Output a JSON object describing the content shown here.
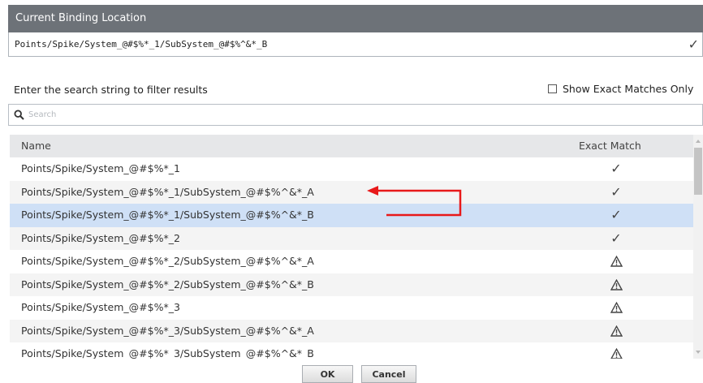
{
  "header": {
    "title": "Current Binding Location"
  },
  "binding": {
    "path": "Points/Spike/System_@#$%*_1/SubSystem_@#$%^&*_B",
    "check_icon": "check-icon"
  },
  "filter": {
    "label": "Enter the search string to filter results",
    "exact_only_label": "Show Exact Matches Only",
    "exact_only_checked": false,
    "search_placeholder": "Search",
    "search_value": ""
  },
  "table": {
    "columns": {
      "name": "Name",
      "exact_match": "Exact Match"
    },
    "rows": [
      {
        "name": "Points/Spike/System_@#$%*_1",
        "match": "check"
      },
      {
        "name": "Points/Spike/System_@#$%*_1/SubSystem_@#$%^&*_A",
        "match": "check"
      },
      {
        "name": "Points/Spike/System_@#$%*_1/SubSystem_@#$%^&*_B",
        "match": "check",
        "selected": true
      },
      {
        "name": "Points/Spike/System_@#$%*_2",
        "match": "check"
      },
      {
        "name": "Points/Spike/System_@#$%*_2/SubSystem_@#$%^&*_A",
        "match": "warning"
      },
      {
        "name": "Points/Spike/System_@#$%*_2/SubSystem_@#$%^&*_B",
        "match": "warning"
      },
      {
        "name": "Points/Spike/System_@#$%*_3",
        "match": "warning"
      },
      {
        "name": "Points/Spike/System_@#$%*_3/SubSystem_@#$%^&*_A",
        "match": "warning"
      },
      {
        "name": "Points/Spike/System_@#$%*_3/SubSystem_@#$%^&*_B",
        "match": "warning"
      }
    ]
  },
  "buttons": {
    "ok": "OK",
    "cancel": "Cancel"
  },
  "colors": {
    "header_bg": "#6d7278",
    "selected_row": "#cfe0f6",
    "annotation_arrow": "#e8191a"
  }
}
